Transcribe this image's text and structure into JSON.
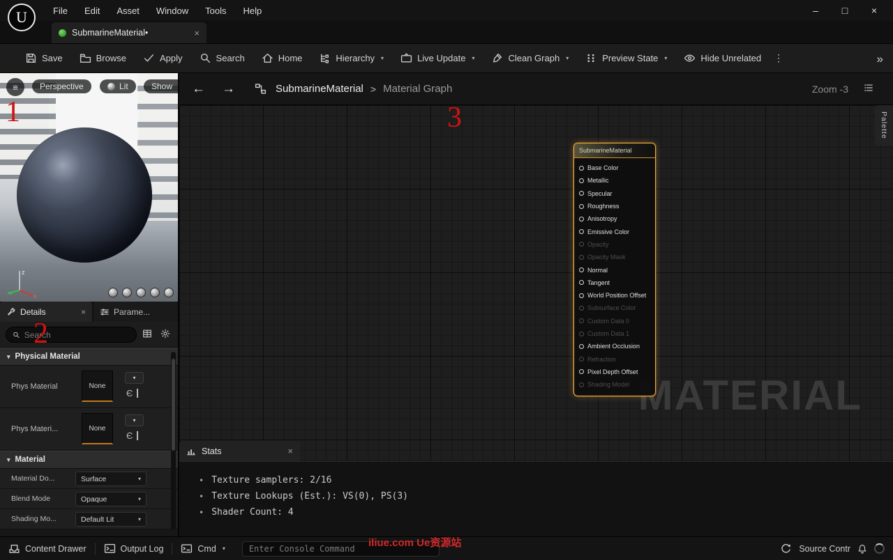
{
  "titlebar": {
    "menu": [
      {
        "label": "File"
      },
      {
        "label": "Edit"
      },
      {
        "label": "Asset"
      },
      {
        "label": "Window"
      },
      {
        "label": "Tools"
      },
      {
        "label": "Help"
      }
    ]
  },
  "tab": {
    "label": "SubmarineMaterial•"
  },
  "toolbar": {
    "save": "Save",
    "browse": "Browse",
    "apply": "Apply",
    "search": "Search",
    "home": "Home",
    "hierarchy": "Hierarchy",
    "live_update": "Live Update",
    "clean_graph": "Clean Graph",
    "preview_state": "Preview State",
    "hide_unrelated": "Hide Unrelated"
  },
  "viewport": {
    "perspective": "Perspective",
    "lit": "Lit",
    "show": "Show",
    "axis_z": "z",
    "axis_x": "x"
  },
  "details": {
    "tab_details": "Details",
    "tab_parameters": "Parame...",
    "search_placeholder": "Search",
    "section_physical": "Physical Material",
    "rows_physical": [
      {
        "label": "Phys Material",
        "value": "None"
      },
      {
        "label": "Phys Materi...",
        "value": "None"
      }
    ],
    "section_material": "Material",
    "rows_material": [
      {
        "label": "Material Do...",
        "value": "Surface"
      },
      {
        "label": "Blend Mode",
        "value": "Opaque"
      },
      {
        "label": "Shading Mo...",
        "value": "Default Lit"
      }
    ]
  },
  "graph": {
    "breadcrumb_root": "SubmarineMaterial",
    "breadcrumb_sep": ">",
    "breadcrumb_current": "Material Graph",
    "zoom_label": "Zoom -3",
    "palette_label": "Palette",
    "watermark": "MATERIAL",
    "node": {
      "title": "SubmarineMaterial",
      "pins": [
        {
          "label": "Base Color",
          "enabled": true
        },
        {
          "label": "Metallic",
          "enabled": true
        },
        {
          "label": "Specular",
          "enabled": true
        },
        {
          "label": "Roughness",
          "enabled": true
        },
        {
          "label": "Anisotropy",
          "enabled": true
        },
        {
          "label": "Emissive Color",
          "enabled": true
        },
        {
          "label": "Opacity",
          "enabled": false
        },
        {
          "label": "Opacity Mask",
          "enabled": false
        },
        {
          "label": "Normal",
          "enabled": true
        },
        {
          "label": "Tangent",
          "enabled": true
        },
        {
          "label": "World Position Offset",
          "enabled": true
        },
        {
          "label": "Subsurface Color",
          "enabled": false
        },
        {
          "label": "Custom Data 0",
          "enabled": false
        },
        {
          "label": "Custom Data 1",
          "enabled": false
        },
        {
          "label": "Ambient Occlusion",
          "enabled": true
        },
        {
          "label": "Refraction",
          "enabled": false
        },
        {
          "label": "Pixel Depth Offset",
          "enabled": true
        },
        {
          "label": "Shading Model",
          "enabled": false
        }
      ]
    }
  },
  "stats": {
    "tab_label": "Stats",
    "lines": [
      {
        "text": "Texture samplers: 2/16"
      },
      {
        "text": "Texture Lookups (Est.): VS(0), PS(3)"
      },
      {
        "text": "Shader Count: 4"
      }
    ]
  },
  "statusbar": {
    "content_drawer": "Content Drawer",
    "output_log": "Output Log",
    "cmd": "Cmd",
    "console_placeholder": "Enter Console Command",
    "source_control": "Source Contr",
    "watermark_text": "iliue.com Ue资源站"
  },
  "annotations": [
    {
      "label": "1"
    },
    {
      "label": "2"
    },
    {
      "label": "3"
    }
  ],
  "icons": {
    "ue_logo": "U",
    "minimize": "–",
    "maximize": "□",
    "close": "×",
    "chevron": "▾",
    "overflow": "»",
    "kebab": "⋮",
    "hamburger": "≡",
    "back": "←",
    "forward": "→",
    "bullet": "•",
    "section_arrow": "▾",
    "use_asset": "Є"
  },
  "colors": {
    "selection_orange": "#f0a93c",
    "asset_underline": "#bf7a16",
    "annotation_red": "#cf1212"
  }
}
